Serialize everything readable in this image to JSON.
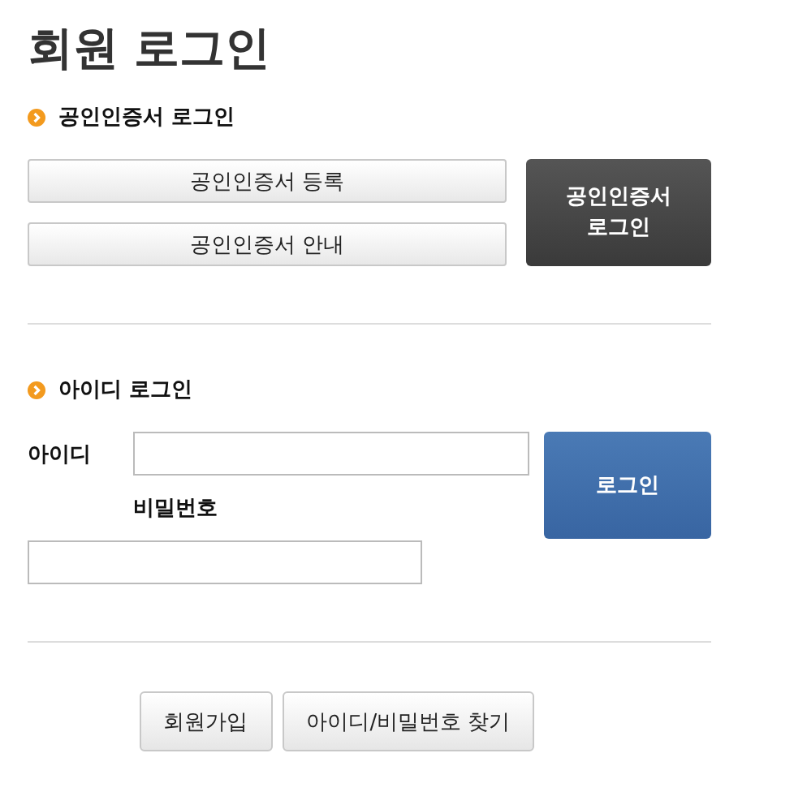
{
  "title": "회원 로그인",
  "cert_section": {
    "heading": "공인인증서 로그인",
    "buttons": [
      "공인인증서 등록",
      "공인인증서 안내"
    ],
    "login_button": "공인인증서\n로그인"
  },
  "id_section": {
    "heading": "아이디 로그인",
    "id_label": "아이디",
    "password_label": "비밀번호",
    "login_button": "로그인"
  },
  "footer_buttons": [
    "회원가입",
    "아이디/비밀번호 찾기"
  ]
}
